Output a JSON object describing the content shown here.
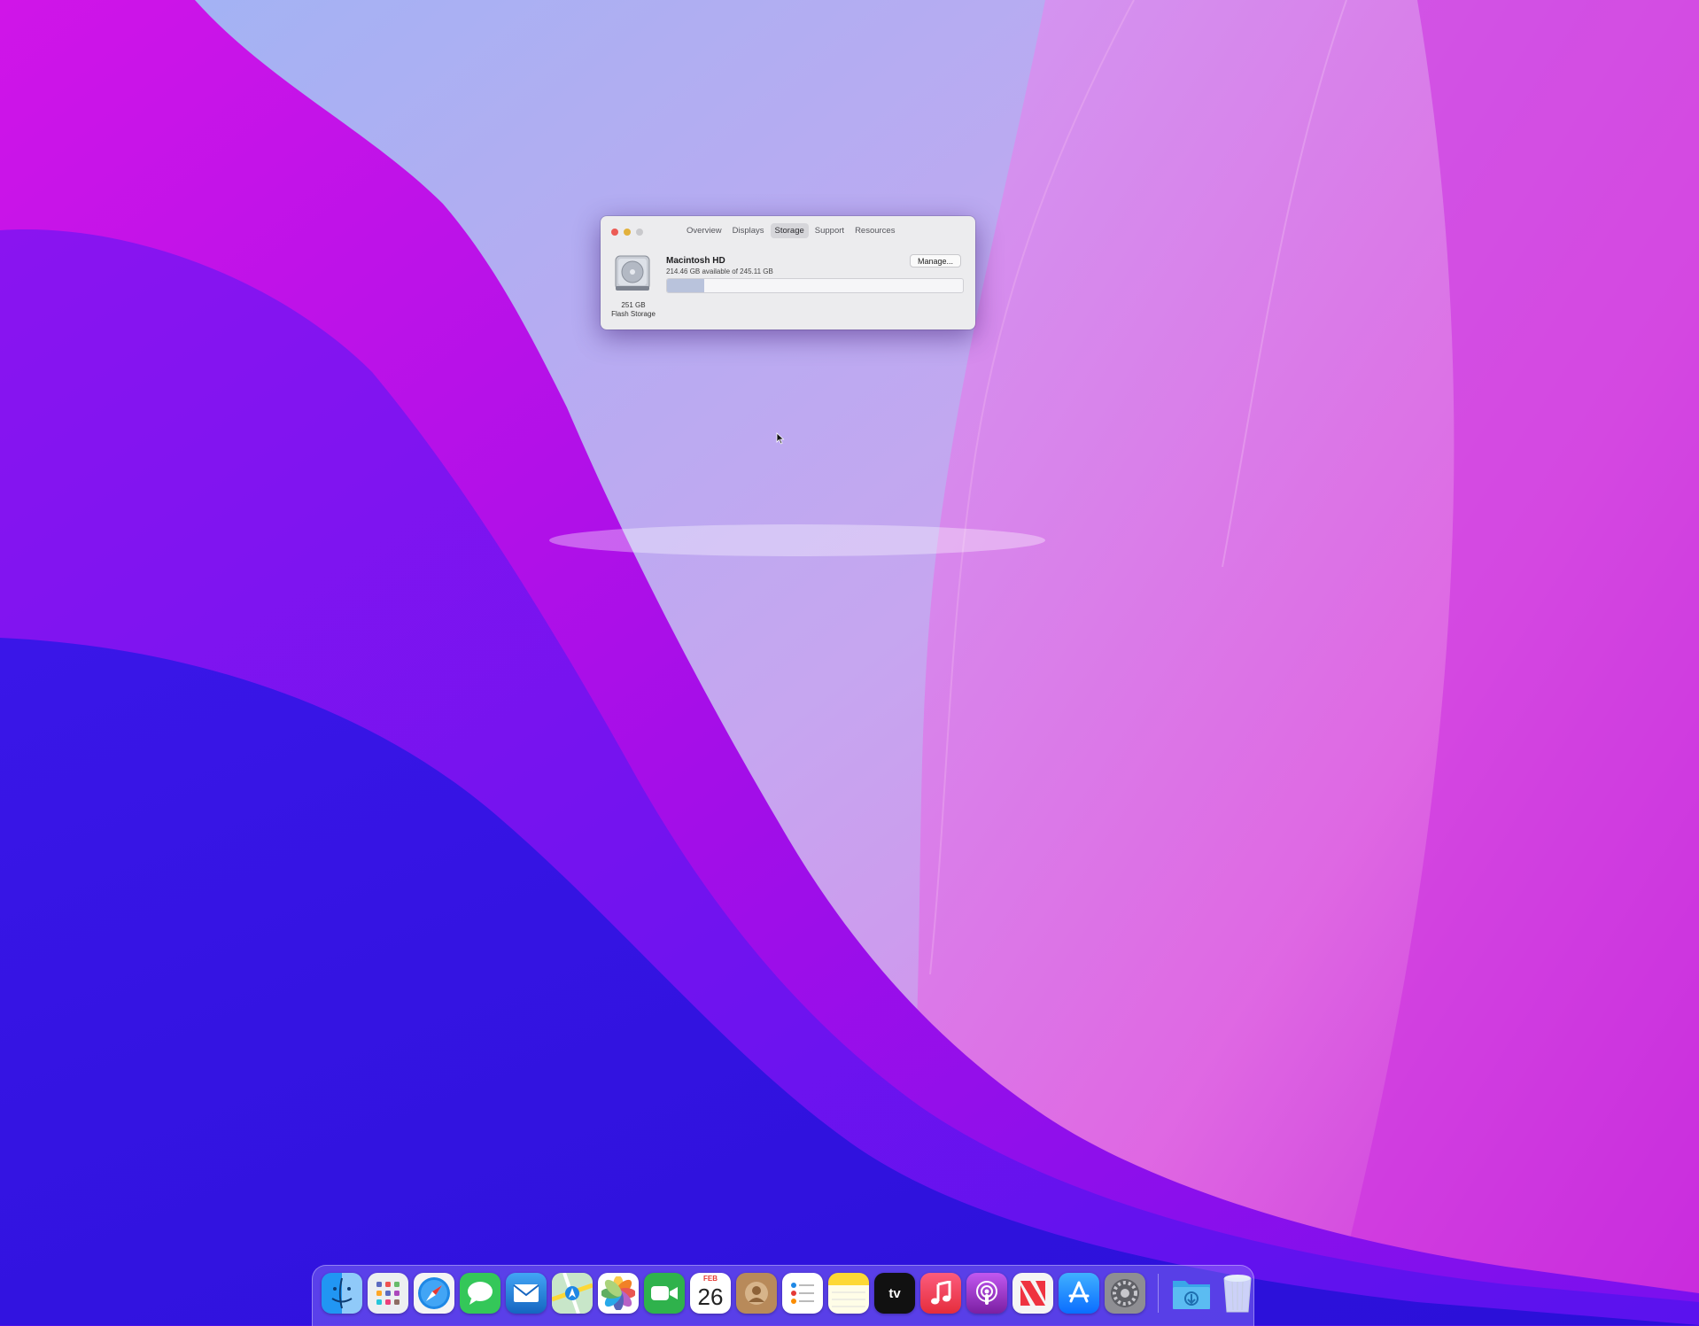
{
  "window": {
    "tabs": [
      {
        "label": "Overview",
        "active": false
      },
      {
        "label": "Displays",
        "active": false
      },
      {
        "label": "Storage",
        "active": true
      },
      {
        "label": "Support",
        "active": false
      },
      {
        "label": "Resources",
        "active": false
      }
    ],
    "disk": {
      "name": "Macintosh HD",
      "availability": "214.46 GB available of 245.11 GB",
      "capacity": "251 GB",
      "type": "Flash Storage",
      "used_fraction": 0.125
    },
    "manage_label": "Manage..."
  },
  "dock": {
    "apps": [
      {
        "name": "Finder",
        "icon": "finder-icon",
        "color": "#1e88e5"
      },
      {
        "name": "Launchpad",
        "icon": "launchpad-icon",
        "color": "#eceff1"
      },
      {
        "name": "Safari",
        "icon": "safari-icon",
        "color": "#1976d2"
      },
      {
        "name": "Messages",
        "icon": "messages-icon",
        "color": "#34c759"
      },
      {
        "name": "Mail",
        "icon": "mail-icon",
        "color": "#2196f3"
      },
      {
        "name": "Maps",
        "icon": "maps-icon",
        "color": "#7cb342"
      },
      {
        "name": "Photos",
        "icon": "photos-icon",
        "color": "#ffffff"
      },
      {
        "name": "FaceTime",
        "icon": "facetime-icon",
        "color": "#2fb24c"
      },
      {
        "name": "Calendar",
        "icon": "calendar-icon",
        "color": "#ffffff",
        "month": "FEB",
        "day": "26"
      },
      {
        "name": "Contacts",
        "icon": "contacts-icon",
        "color": "#b88a5a"
      },
      {
        "name": "Reminders",
        "icon": "reminders-icon",
        "color": "#ffffff"
      },
      {
        "name": "Notes",
        "icon": "notes-icon",
        "color": "#fdd835"
      },
      {
        "name": "TV",
        "icon": "apple-tv-icon",
        "color": "#111111",
        "label": "tv"
      },
      {
        "name": "Music",
        "icon": "music-icon",
        "color": "#fa3c55"
      },
      {
        "name": "Podcasts",
        "icon": "podcasts-icon",
        "color": "#9c3cdc"
      },
      {
        "name": "News",
        "icon": "news-icon",
        "color": "#f5f5f5"
      },
      {
        "name": "App Store",
        "icon": "app-store-icon",
        "color": "#1a8cff"
      },
      {
        "name": "System Preferences",
        "icon": "system-preferences-icon",
        "color": "#8e8e93"
      },
      {
        "name": "Downloads",
        "icon": "downloads-folder-icon",
        "color": "#3aa6e8"
      },
      {
        "name": "Trash",
        "icon": "trash-icon",
        "color": "#dfe7f5"
      }
    ]
  }
}
